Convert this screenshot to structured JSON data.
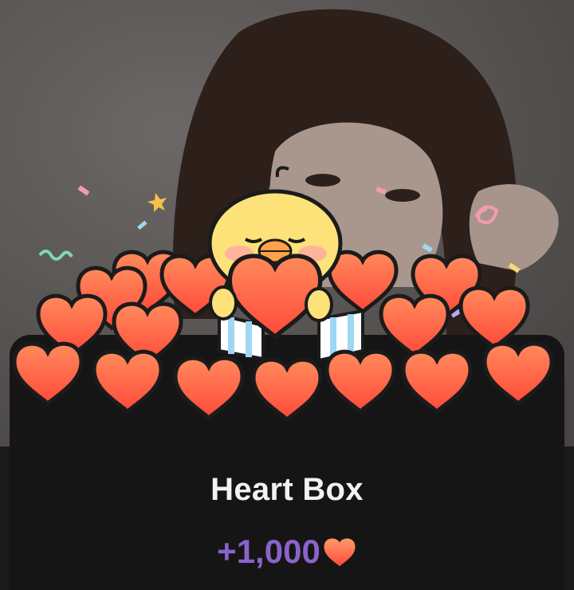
{
  "popup": {
    "title": "Heart Box",
    "reward_amount": "+1,000",
    "reward_icon": "heart-icon"
  },
  "colors": {
    "sheet_bg": "#151515",
    "title_text": "#f2f2f2",
    "reward_text": "#8a63c9",
    "heart_fill": "#ff6a45",
    "chick_body": "#fde27a"
  }
}
